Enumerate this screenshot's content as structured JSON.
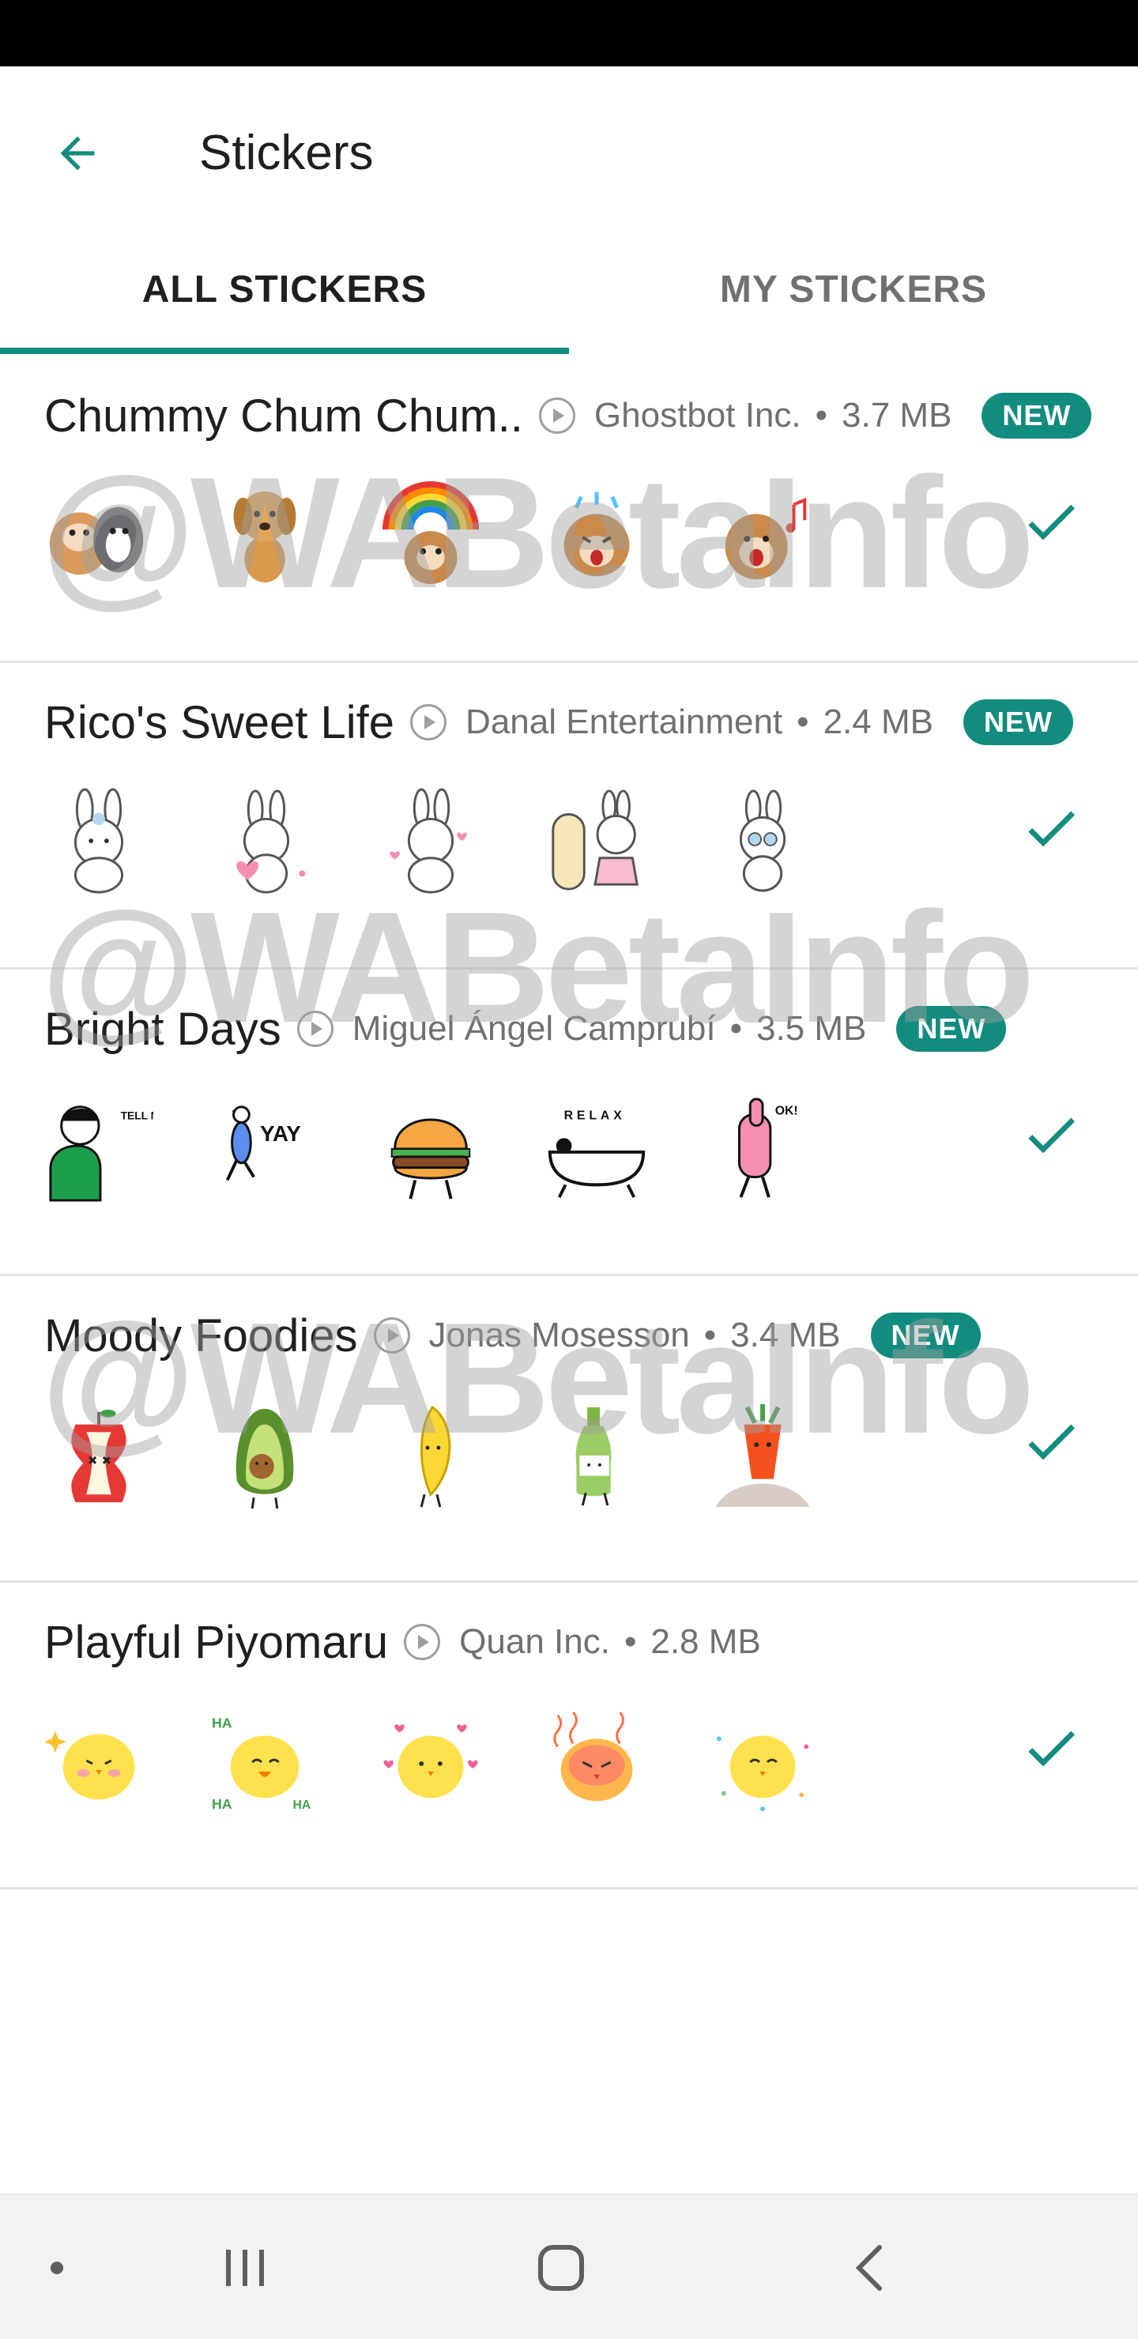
{
  "app": {
    "title": "Stickers"
  },
  "tabs": [
    {
      "label": "ALL STICKERS",
      "active": true
    },
    {
      "label": "MY STICKERS",
      "active": false
    }
  ],
  "watermark": "@WABetaInfo",
  "colors": {
    "accent": "#128c7e",
    "check": "#128c7e",
    "meta_text": "#707070"
  },
  "packs": [
    {
      "name": "Chummy Chum Chum..",
      "publisher": "Ghostbot Inc.",
      "separator": "•",
      "size": "3.7 MB",
      "badge": "NEW",
      "installed": true,
      "stickers": [
        "dog-and-cat-sticker",
        "golden-puppy-sticker",
        "puppy-rainbow-sticker",
        "puppy-crying-sticker",
        "puppy-singing-sticker"
      ]
    },
    {
      "name": "Rico's Sweet Life",
      "publisher": "Danal Entertainment",
      "separator": "•",
      "size": "2.4 MB",
      "badge": "NEW",
      "installed": true,
      "stickers": [
        "bunny-sitting-sticker",
        "bunny-heart-sticker",
        "bunny-eating-sticker",
        "bunny-mirror-sticker",
        "bunny-glasses-sticker"
      ]
    },
    {
      "name": "Bright Days",
      "publisher": "Miguel Ángel Camprubí",
      "separator": "•",
      "size": "3.5 MB",
      "badge": "NEW",
      "installed": true,
      "stickers": [
        "tell-me-more-sticker",
        "yay-sticker",
        "burger-sticker",
        "relax-bathtub-sticker",
        "ok-thumbs-up-sticker"
      ]
    },
    {
      "name": "Moody Foodies",
      "publisher": "Jonas Mosesson",
      "separator": "•",
      "size": "3.4 MB",
      "badge": "NEW",
      "installed": true,
      "stickers": [
        "apple-core-sticker",
        "avocado-sticker",
        "banana-sticker",
        "bottle-sticker",
        "carrot-sticker"
      ]
    },
    {
      "name": "Playful Piyomaru",
      "publisher": "Quan Inc.",
      "separator": "•",
      "size": "2.8 MB",
      "badge": "",
      "installed": true,
      "stickers": [
        "chick-sparkle-sticker",
        "chick-laughing-sticker",
        "chick-hearts-sticker",
        "chick-angry-sticker",
        "chick-confetti-sticker"
      ]
    }
  ],
  "thumb_texts": {
    "tell_me_more": "TELL ME MORE",
    "yay": "YAY",
    "relax": "RELAX",
    "ok": "OK!",
    "ha": "HA"
  },
  "navbar": {
    "buttons": [
      "dot-icon",
      "recent-apps-icon",
      "home-icon",
      "back-nav-icon"
    ]
  }
}
